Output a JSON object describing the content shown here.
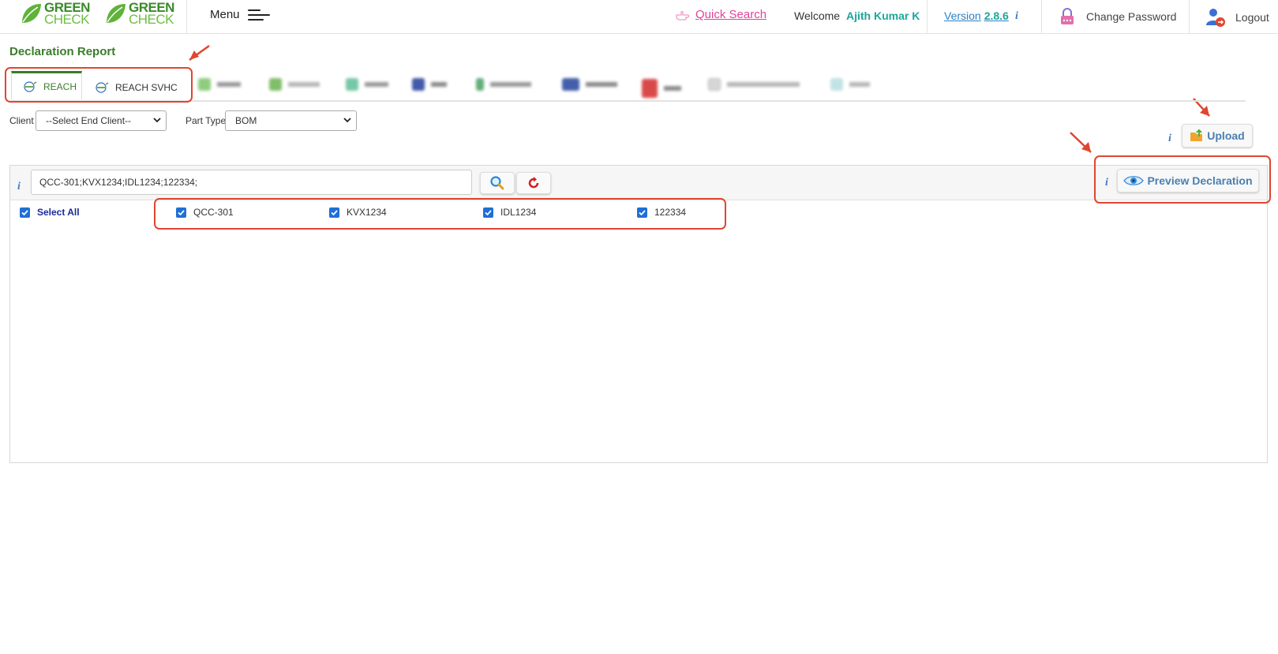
{
  "header": {
    "logo_top": "GREEN",
    "logo_bottom": "CHECK",
    "menu_label": "Menu",
    "quick_search": "Quick Search",
    "welcome_label": "Welcome",
    "user_name": "Ajith Kumar K",
    "version_label": "Version",
    "version_number": "2.8.6",
    "info_glyph": "i",
    "change_password": "Change Password",
    "logout": "Logout"
  },
  "page": {
    "title": "Declaration Report"
  },
  "tabs": [
    {
      "label": "REACH",
      "active": true,
      "icon": "reach-logo-icon"
    },
    {
      "label": "REACH SVHC",
      "active": false,
      "icon": "reach-logo-icon"
    }
  ],
  "filters": {
    "client_label": "Client",
    "client_value": "--Select End Client--",
    "part_type_label": "Part Type",
    "part_type_value": "BOM"
  },
  "actions": {
    "upload": "Upload",
    "preview": "Preview Declaration"
  },
  "search": {
    "value": "QCC-301;KVX1234;IDL1234;122334;"
  },
  "parts": {
    "select_all": "Select All",
    "items": [
      "QCC-301",
      "KVX1234",
      "IDL1234",
      "122334"
    ]
  },
  "colors": {
    "brand_green": "#3a7d2a",
    "accent_teal": "#1aa79a",
    "link_blue": "#2a82c6",
    "annotation_red": "#e0462f",
    "quick_search_pink": "#e0449b"
  }
}
